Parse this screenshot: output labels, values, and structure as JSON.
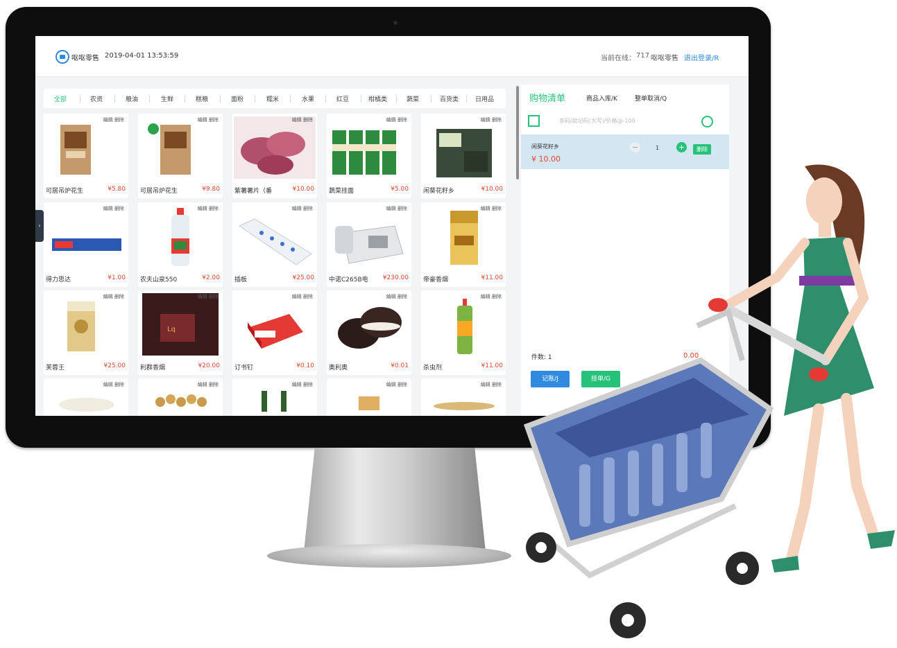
{
  "header": {
    "brand": "呕呕零售",
    "datetime": "2019-04-01 13:53:59",
    "online_label": "当前在线：",
    "online_count": "717",
    "user": "呕呕零售",
    "logout": "退出登录/R"
  },
  "categories": [
    "全部",
    "农资",
    "粮油",
    "生鲜",
    "糕粮",
    "面粉",
    "糯米",
    "水果",
    "红豆",
    "柑橘类",
    "蔬菜",
    "百货类",
    "日用品"
  ],
  "card_actions": {
    "edit": "编辑",
    "delete": "删除"
  },
  "products": [
    {
      "name": "可居吊炉花生",
      "price": "¥5.80"
    },
    {
      "name": "可居吊炉花生",
      "price": "¥9.80"
    },
    {
      "name": "紫薯薯片（番",
      "price": "¥10.00"
    },
    {
      "name": "蔬菜挂面",
      "price": "¥5.00"
    },
    {
      "name": "闲葵花籽乡",
      "price": "¥10.00"
    },
    {
      "name": "得力思达",
      "price": "¥1.00"
    },
    {
      "name": "农夫山泉550",
      "price": "¥2.00"
    },
    {
      "name": "插板",
      "price": "¥25.00"
    },
    {
      "name": "中诺C265B电",
      "price": "¥230.00"
    },
    {
      "name": "帝豪香烟",
      "price": "¥11.00"
    },
    {
      "name": "芙蓉王",
      "price": "¥25.00"
    },
    {
      "name": "利群香烟",
      "price": "¥20.00"
    },
    {
      "name": "订书钉",
      "price": "¥0.10"
    },
    {
      "name": "奥利奥",
      "price": "¥0.01"
    },
    {
      "name": "杀虫剂",
      "price": "¥11.00"
    }
  ],
  "cart": {
    "title": "购物清单",
    "tab_in": "商品入库/K",
    "tab_cancel": "整单取消/Q",
    "search_placeholder": "条码/助记码(大写)/价格@-100",
    "item": {
      "name": "闲葵花籽乡",
      "price": "¥ 10.00",
      "qty": "1",
      "delete": "删除"
    },
    "count": "件数: 1",
    "total": "0.00",
    "btn_account": "记账/J",
    "btn_hold": "挂单/G"
  },
  "colors": {
    "accent": "#27c27a",
    "brand": "#2f8ae0",
    "price": "#e0452a",
    "cart_row": "#d5e6f3"
  }
}
